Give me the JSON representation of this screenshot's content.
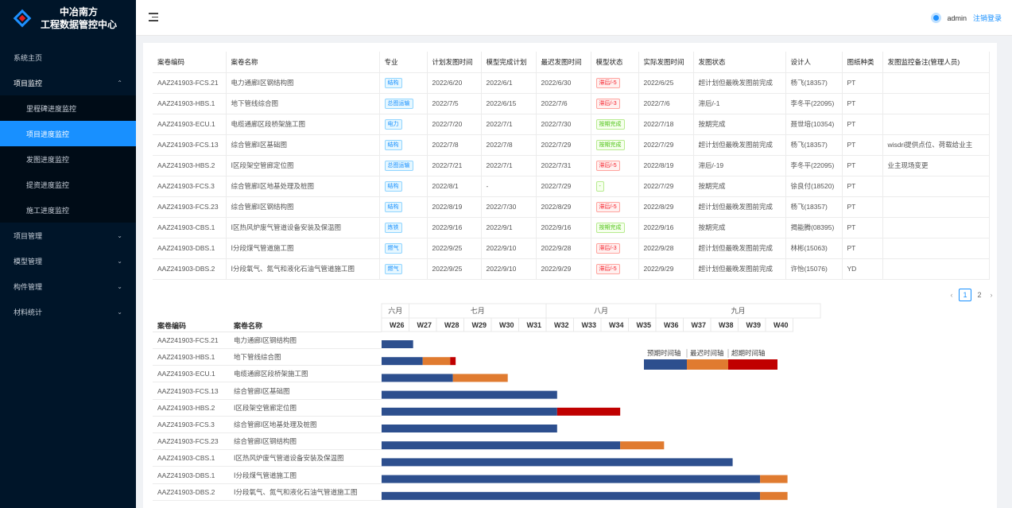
{
  "brand": {
    "line1": "中冶南方",
    "line2": "工程数据管控中心"
  },
  "menu": {
    "home": "系统主页",
    "project_monitor": "项目监控",
    "sub": [
      "里程碑进度监控",
      "项目进度监控",
      "发图进度监控",
      "提资进度监控",
      "施工进度监控"
    ],
    "groups": [
      "项目管理",
      "模型管理",
      "构件管理",
      "材料统计"
    ]
  },
  "header": {
    "user": "admin",
    "logout": "注销登录"
  },
  "colors": {
    "primary": "#1890ff",
    "plan": "#2d4f8e",
    "late": "#e07b30",
    "over": "#c00000",
    "sidebar": "#001529"
  },
  "table": {
    "headers": [
      "案卷编码",
      "案卷名称",
      "专业",
      "计划发图时间",
      "模型完成计划",
      "最迟发图时间",
      "模型状态",
      "实际发图时间",
      "发图状态",
      "设计人",
      "图纸种类",
      "发图监控备注(管理人员)"
    ],
    "rows": [
      {
        "code": "AAZ241903-FCS.21",
        "name": "电力通廊Ⅰ区钢结构图",
        "major": "结构",
        "mc": "blue",
        "plan": "2022/6/20",
        "model": "2022/6/1",
        "latest": "2022/6/30",
        "ms": "滞后/-5",
        "msc": "red",
        "actual": "2022/6/25",
        "status": "超计划但最晚发图前完成",
        "designer": "杨飞(18357)",
        "kind": "PT",
        "note": ""
      },
      {
        "code": "AAZ241903-HBS.1",
        "name": "地下管线综合图",
        "major": "总图运输",
        "mc": "blue",
        "plan": "2022/7/5",
        "model": "2022/6/15",
        "latest": "2022/7/6",
        "ms": "滞后/-3",
        "msc": "red",
        "actual": "2022/7/6",
        "status": "滞后/-1",
        "designer": "李冬平(22095)",
        "kind": "PT",
        "note": ""
      },
      {
        "code": "AAZ241903-ECU.1",
        "name": "电缆通廊区段桥架施工图",
        "major": "电力",
        "mc": "blue",
        "plan": "2022/7/20",
        "model": "2022/7/1",
        "latest": "2022/7/30",
        "ms": "按期完成",
        "msc": "green",
        "actual": "2022/7/18",
        "status": "按期完成",
        "designer": "聂世培(10354)",
        "kind": "PT",
        "note": ""
      },
      {
        "code": "AAZ241903-FCS.13",
        "name": "综合管廊Ⅰ区基础图",
        "major": "结构",
        "mc": "blue",
        "plan": "2022/7/8",
        "model": "2022/7/8",
        "latest": "2022/7/29",
        "ms": "按期完成",
        "msc": "green",
        "actual": "2022/7/29",
        "status": "超计划但最晚发图前完成",
        "designer": "杨飞(18357)",
        "kind": "PT",
        "note": "wisdri提供点位、荷载给业主"
      },
      {
        "code": "AAZ241903-HBS.2",
        "name": "Ⅰ区段架空管廊定位图",
        "major": "总图运输",
        "mc": "blue",
        "plan": "2022/7/21",
        "model": "2022/7/1",
        "latest": "2022/7/31",
        "ms": "滞后/-5",
        "msc": "red",
        "actual": "2022/8/19",
        "status": "滞后/-19",
        "designer": "李冬平(22095)",
        "kind": "PT",
        "note": "业主现场变更"
      },
      {
        "code": "AAZ241903-FCS.3",
        "name": "综合管廊Ⅰ区地基处理及桩图",
        "major": "结构",
        "mc": "blue",
        "plan": "2022/8/1",
        "model": "-",
        "latest": "2022/7/29",
        "ms": "-",
        "msc": "green",
        "actual": "2022/7/29",
        "status": "按期完成",
        "designer": "徐良付(18520)",
        "kind": "PT",
        "note": ""
      },
      {
        "code": "AAZ241903-FCS.23",
        "name": "综合管廊Ⅰ区钢结构图",
        "major": "结构",
        "mc": "blue",
        "plan": "2022/8/19",
        "model": "2022/7/30",
        "latest": "2022/8/29",
        "ms": "滞后/-5",
        "msc": "red",
        "actual": "2022/8/29",
        "status": "超计划但最晚发图前完成",
        "designer": "杨飞(18357)",
        "kind": "PT",
        "note": ""
      },
      {
        "code": "AAZ241903-CBS.1",
        "name": "Ⅰ区热风炉废气管道设备安装及保温图",
        "major": "炼铁",
        "mc": "blue",
        "plan": "2022/9/16",
        "model": "2022/9/1",
        "latest": "2022/9/16",
        "ms": "按期完成",
        "msc": "green",
        "actual": "2022/9/16",
        "status": "按期完成",
        "designer": "揭能腾(08395)",
        "kind": "PT",
        "note": ""
      },
      {
        "code": "AAZ241903-DBS.1",
        "name": "Ⅰ分段煤气管道施工图",
        "major": "燃气",
        "mc": "blue",
        "plan": "2022/9/25",
        "model": "2022/9/10",
        "latest": "2022/9/28",
        "ms": "滞后/-3",
        "msc": "red",
        "actual": "2022/9/28",
        "status": "超计划但最晚发图前完成",
        "designer": "林彬(15063)",
        "kind": "PT",
        "note": ""
      },
      {
        "code": "AAZ241903-DBS.2",
        "name": "Ⅰ分段氧气、氮气和液化石油气管道施工图",
        "major": "燃气",
        "mc": "blue",
        "plan": "2022/9/25",
        "model": "2022/9/10",
        "latest": "2022/9/29",
        "ms": "滞后/-5",
        "msc": "red",
        "actual": "2022/9/29",
        "status": "超计划但最晚发图前完成",
        "designer": "许怡(15076)",
        "kind": "YD",
        "note": ""
      }
    ]
  },
  "pagination": {
    "pages": [
      "1",
      "2"
    ],
    "current": "1",
    "prev": "‹",
    "next": "›"
  },
  "gantt": {
    "left_headers": [
      "案卷编码",
      "案卷名称"
    ],
    "months": [
      {
        "label": "六月",
        "weeks": 1
      },
      {
        "label": "七月",
        "weeks": 5
      },
      {
        "label": "八月",
        "weeks": 4
      },
      {
        "label": "九月",
        "weeks": 6
      }
    ],
    "weeks": [
      "W26",
      "W27",
      "W28",
      "W29",
      "W30",
      "W31",
      "W32",
      "W33",
      "W34",
      "W35",
      "W36",
      "W37",
      "W38",
      "W39",
      "W40"
    ],
    "legend": [
      "预期时间轴",
      "最迟时间轴",
      "超期时间轴"
    ]
  },
  "chart_data": {
    "type": "bar",
    "title": "",
    "start_week": "W26",
    "x_unit": "week",
    "categories": [
      "AAZ241903-FCS.21",
      "AAZ241903-HBS.1",
      "AAZ241903-ECU.1",
      "AAZ241903-FCS.13",
      "AAZ241903-HBS.2",
      "AAZ241903-FCS.3",
      "AAZ241903-FCS.23",
      "AAZ241903-CBS.1",
      "AAZ241903-DBS.1",
      "AAZ241903-DBS.2"
    ],
    "series": [
      {
        "name": "预期时间轴",
        "values": [
          1.15,
          1.5,
          2.6,
          6.4,
          6.4,
          6.4,
          8.7,
          12.8,
          13.8,
          13.8
        ]
      },
      {
        "name": "最迟时间轴",
        "values": [
          0,
          1.0,
          2.0,
          0,
          0,
          0,
          1.6,
          0,
          1.0,
          1.0
        ]
      },
      {
        "name": "超期时间轴",
        "values": [
          0,
          0.2,
          0,
          0,
          2.3,
          0,
          0,
          0,
          0,
          0
        ]
      }
    ]
  }
}
